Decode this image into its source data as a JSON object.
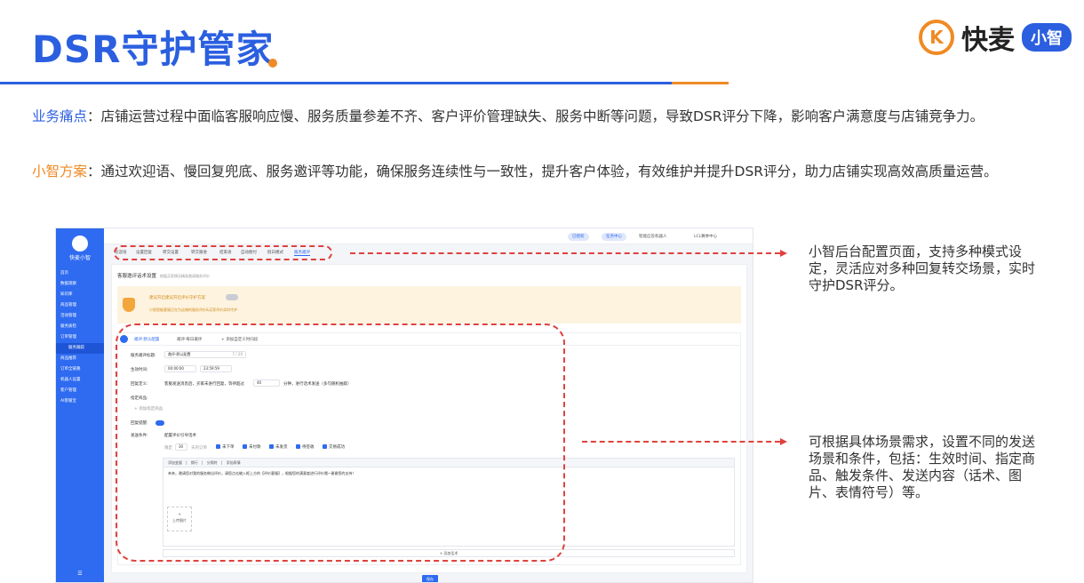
{
  "slide": {
    "title": "DSR守护管家",
    "brand_logo_letter": "K",
    "brand_name": "快麦",
    "brand_badge": "小智",
    "pain_label": "业务痛点",
    "pain_text": "：店铺运营过程中面临客服响应慢、服务质量参差不齐、客户评价管理缺失、服务中断等问题，导致DSR评分下降，影响客户满意度与店铺竞争力。",
    "plan_label": "小智方案",
    "plan_text": "：通过欢迎语、慢回复兜底、服务邀评等功能，确保服务连续性与一致性，提升客户体验，有效维护并提升DSR评分，助力店铺实现高效高质量运营。",
    "note1": "小智后台配置页面，支持多种模式设定，灵活应对多种回复转交场景，实时守护DSR评分。",
    "note2": "可根据具体场景需求，设置不同的发送场景和条件，包括：生效时间、指定商品、触发条件、发送内容（话术、图片、表情符号）等。"
  },
  "app": {
    "brand": "快麦小智",
    "sidebar": [
      "首页",
      "数据观察",
      "知识库",
      "商品管理",
      "活动管理",
      "服务质检",
      "订单管理",
      "服务跟踪",
      "商品推荐",
      "订单全链路",
      "机器人设置",
      "客户管理",
      "AI客服宝"
    ],
    "sidebar_foot": "☰",
    "topbar": {
      "pill1": "已授权",
      "pill2": "任务中心",
      "text1": "智能应答机器人",
      "text2": "LCL赛季中心"
    },
    "tabs": [
      "欢迎语",
      "设置回复",
      "转交设置",
      "转交跟进",
      "结束语",
      "自动催付",
      "假日模式",
      "服务邀评"
    ],
    "page_title": "客服邀评话术设置",
    "page_subtitle": "根据买家情况精准邀请服务评价",
    "banner_title": "建议开启建议开启评价守护方案",
    "banner_text": "小智智能客服正在为店铺的服务评价&买家评价实时守护",
    "panel_tabs": [
      "邀评·默认配置",
      "邀评·每日邀评",
      "+ 添加自定义时间段"
    ],
    "labels": {
      "name": "服务邀评标题:",
      "time": "生效时间:",
      "rule": "回复定义:",
      "goods": "指定商品:",
      "reply": "回复提醒:",
      "cond": "发送条件:"
    },
    "values": {
      "name": "邀评-默认配置",
      "name_count": "7 / 20",
      "time_start": "00:00:00",
      "time_end": "23:59:59",
      "rule_text": "客服发送消息后，买家未进行回复，等待超过",
      "rule_num": "40",
      "rule_suffix": "分钟，进行话术发送（多句随机抽取）",
      "goods_btn": "+ 添加指定商品",
      "cond_text": "配置评价引导话术",
      "days_label": "限定",
      "days": "30",
      "days_suffix": "天内订单"
    },
    "checks": [
      "未下单",
      "未付款",
      "未发货",
      "待签收",
      "交易成功"
    ],
    "editor_tools": "添加变量 | 换行 | 分隔符 | 添加表情",
    "editor_text": "亲亲，邀请您对我的服务做出评价，请您点击输入框上方的【评价客服】，根据您的满意度进行评价哦~谢谢您的支持！",
    "upload_plus": "+",
    "upload_label": "上传图片",
    "add_row": "+ 添加话术",
    "save": "保存"
  }
}
